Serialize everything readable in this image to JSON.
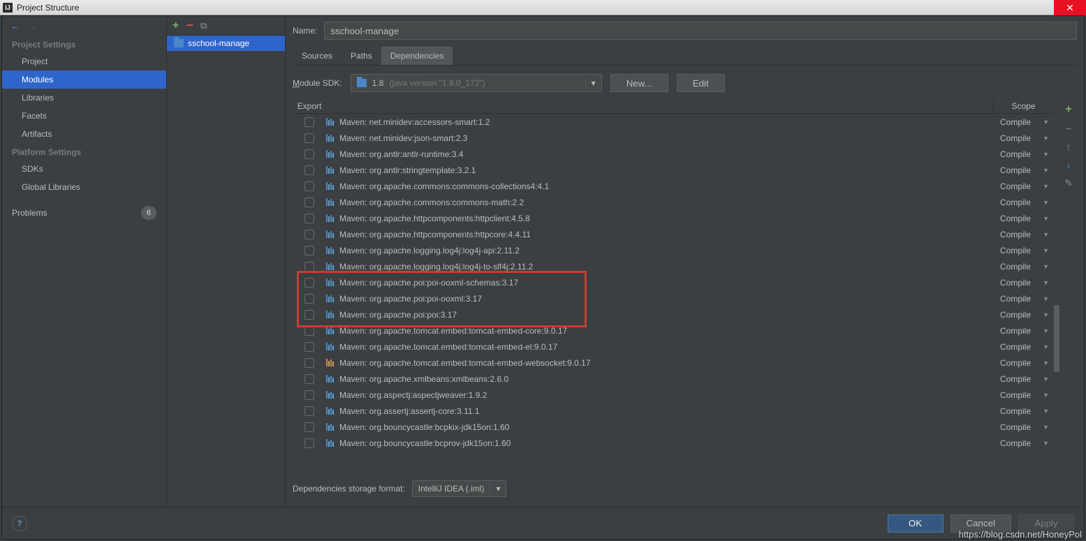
{
  "window": {
    "title": "Project Structure"
  },
  "leftNav": {
    "projectSettingsHeader": "Project Settings",
    "projectSettings": [
      "Project",
      "Modules",
      "Libraries",
      "Facets",
      "Artifacts"
    ],
    "selected": "Modules",
    "platformSettingsHeader": "Platform Settings",
    "platformSettings": [
      "SDKs",
      "Global Libraries"
    ],
    "problemsLabel": "Problems",
    "problemsCount": "6"
  },
  "moduleTree": {
    "selected": "sschool-manage"
  },
  "content": {
    "nameLabel": "Name:",
    "nameValue": "sschool-manage",
    "tabs": [
      "Sources",
      "Paths",
      "Dependencies"
    ],
    "activeTab": "Dependencies",
    "sdkLabel": "Module SDK:",
    "sdkValue": "1.8",
    "sdkHint": "(java version \"1.8.0_172\")",
    "newBtn": "New...",
    "editBtn": "Edit",
    "tableHeaders": {
      "export": "Export",
      "scope": "Scope"
    },
    "storageLabel": "Dependencies storage format:",
    "storageValue": "IntelliJ IDEA (.iml)"
  },
  "dependencies": [
    {
      "name": "Maven: net.minidev:accessors-smart:1.2",
      "scope": "Compile",
      "highlight": false
    },
    {
      "name": "Maven: net.minidev:json-smart:2.3",
      "scope": "Compile",
      "highlight": false
    },
    {
      "name": "Maven: org.antlr:antlr-runtime:3.4",
      "scope": "Compile",
      "highlight": false
    },
    {
      "name": "Maven: org.antlr:stringtemplate:3.2.1",
      "scope": "Compile",
      "highlight": false
    },
    {
      "name": "Maven: org.apache.commons:commons-collections4:4.1",
      "scope": "Compile",
      "highlight": false
    },
    {
      "name": "Maven: org.apache.commons:commons-math:2.2",
      "scope": "Compile",
      "highlight": false
    },
    {
      "name": "Maven: org.apache.httpcomponents:httpclient:4.5.8",
      "scope": "Compile",
      "highlight": false
    },
    {
      "name": "Maven: org.apache.httpcomponents:httpcore:4.4.11",
      "scope": "Compile",
      "highlight": false
    },
    {
      "name": "Maven: org.apache.logging.log4j:log4j-api:2.11.2",
      "scope": "Compile",
      "highlight": false
    },
    {
      "name": "Maven: org.apache.logging.log4j:log4j-to-slf4j:2.11.2",
      "scope": "Compile",
      "highlight": false
    },
    {
      "name": "Maven: org.apache.poi:poi-ooxml-schemas:3.17",
      "scope": "Compile",
      "highlight": true
    },
    {
      "name": "Maven: org.apache.poi:poi-ooxml:3.17",
      "scope": "Compile",
      "highlight": true
    },
    {
      "name": "Maven: org.apache.poi:poi:3.17",
      "scope": "Compile",
      "highlight": true
    },
    {
      "name": "Maven: org.apache.tomcat.embed:tomcat-embed-core:9.0.17",
      "scope": "Compile",
      "highlight": false
    },
    {
      "name": "Maven: org.apache.tomcat.embed:tomcat-embed-el:9.0.17",
      "scope": "Compile",
      "highlight": false
    },
    {
      "name": "Maven: org.apache.tomcat.embed:tomcat-embed-websocket:9.0.17",
      "scope": "Compile",
      "highlight": false,
      "web": true
    },
    {
      "name": "Maven: org.apache.xmlbeans:xmlbeans:2.6.0",
      "scope": "Compile",
      "highlight": false
    },
    {
      "name": "Maven: org.aspectj:aspectjweaver:1.9.2",
      "scope": "Compile",
      "highlight": false
    },
    {
      "name": "Maven: org.assertj:assertj-core:3.11.1",
      "scope": "Compile",
      "highlight": false
    },
    {
      "name": "Maven: org.bouncycastle:bcpkix-jdk15on:1.60",
      "scope": "Compile",
      "highlight": false
    },
    {
      "name": "Maven: org.bouncycastle:bcprov-jdk15on:1.60",
      "scope": "Compile",
      "highlight": false
    }
  ],
  "buttons": {
    "ok": "OK",
    "cancel": "Cancel",
    "apply": "Apply"
  },
  "watermark": "https://blog.csdn.net/HoneyPol"
}
